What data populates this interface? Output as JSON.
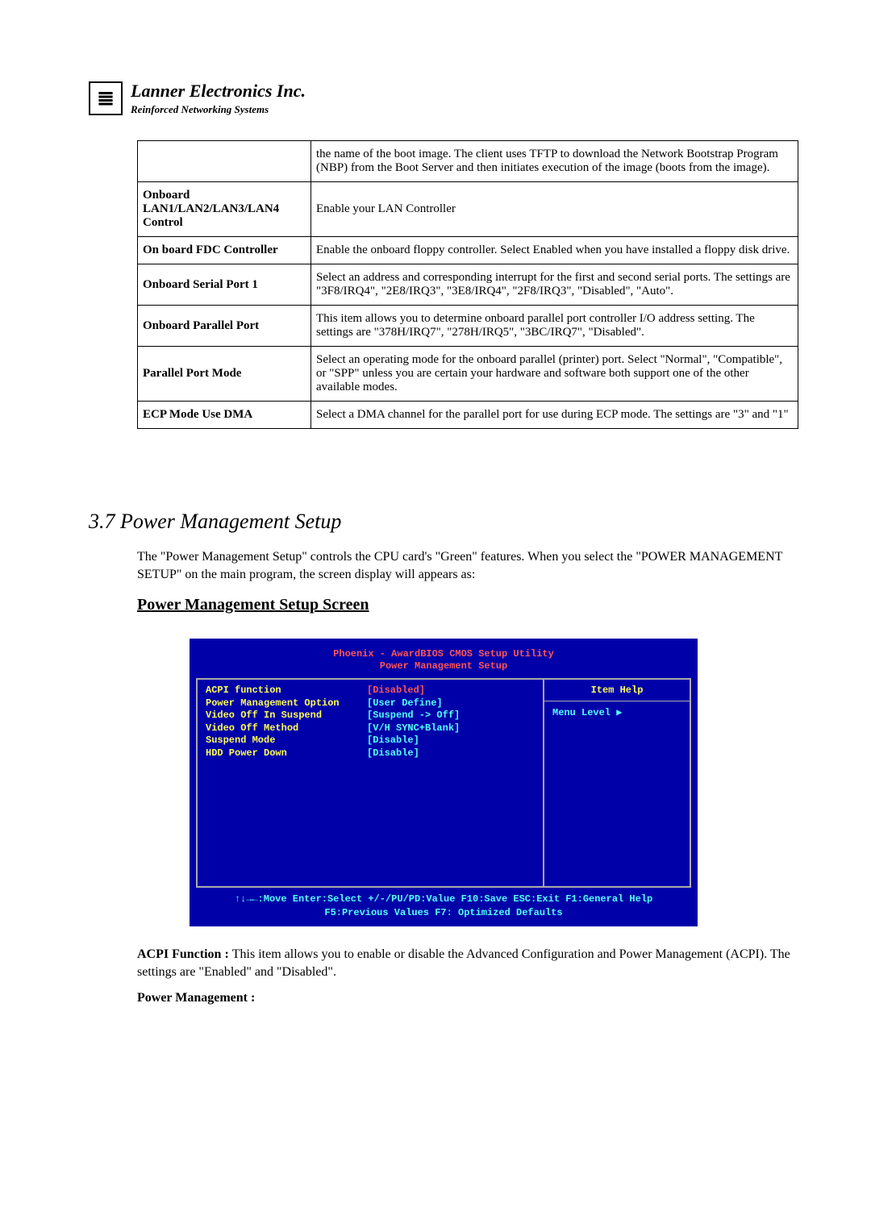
{
  "header": {
    "company": "Lanner Electronics Inc.",
    "tagline": "Reinforced Networking Systems"
  },
  "table": {
    "rows": [
      {
        "label": "",
        "desc": "the name of the boot image. The client uses TFTP to download the Network Bootstrap Program (NBP) from the Boot Server and then initiates execution of the image (boots from the image)."
      },
      {
        "label": "Onboard LAN1/LAN2/LAN3/LAN4 Control",
        "desc": "Enable your LAN Controller"
      },
      {
        "label": "On board FDC Controller",
        "desc": "Enable the onboard floppy controller. Select Enabled when you have installed a floppy disk drive."
      },
      {
        "label": "Onboard Serial Port 1",
        "desc": "Select an address and corresponding interrupt for the first and second serial ports.  The settings are \"3F8/IRQ4\", \"2E8/IRQ3\", \"3E8/IRQ4\", \"2F8/IRQ3\", \"Disabled\", \"Auto\"."
      },
      {
        "label": "Onboard Parallel Port",
        "desc": "This item allows you to determine onboard parallel port controller I/O address setting.  The settings are \"378H/IRQ7\", \"278H/IRQ5\", \"3BC/IRQ7\", \"Disabled\"."
      },
      {
        "label": "Parallel Port Mode",
        "desc": "Select an operating mode for the onboard parallel (printer) port.  Select \"Normal\", \"Compatible\", or \"SPP\" unless you are certain your hardware and software both support one of the other available modes."
      },
      {
        "label": "ECP Mode Use DMA",
        "desc": "Select a DMA channel for the parallel port for use during ECP mode. The settings are \"3\" and \"1\""
      }
    ]
  },
  "section": {
    "title": "3.7 Power Management  Setup",
    "intro": "The \"Power Management Setup\" controls the CPU card's \"Green\" features.  When you select the  \"POWER MANAGEMENT SETUP\" on the main program, the screen display will appears as:",
    "subsection_title": "Power Management Setup Screen"
  },
  "bios": {
    "title1": "Phoenix - AwardBIOS CMOS Setup Utility",
    "title2": "Power Management Setup",
    "rows": [
      {
        "label": "ACPI function",
        "value": "[Disabled]",
        "valueClass": "disabled"
      },
      {
        "label": "Power Management Option",
        "value": "[User Define]"
      },
      {
        "label": "Video Off In Suspend",
        "value": "[Suspend -> Off]"
      },
      {
        "label": "Video Off Method",
        "value": "[V/H SYNC+Blank]"
      },
      {
        "label": "Suspend Mode",
        "value": "[Disable]"
      },
      {
        "label": "HDD Power Down",
        "value": "[Disable]"
      }
    ],
    "item_help": "Item Help",
    "menu_level": "Menu Level    ▶",
    "footer1": "↑↓→←:Move   Enter:Select  +/-/PU/PD:Value   F10:Save  ESC:Exit  F1:General Help",
    "footer2": "F5:Previous Values                   F7: Optimized Defaults"
  },
  "para1_label": "ACPI Function : ",
  "para1_text": "This item allows you to enable or disable the Advanced Configuration and Power Management (ACPI).  The settings are \"Enabled\" and \"Disabled\".",
  "para2_label": "Power Management :"
}
